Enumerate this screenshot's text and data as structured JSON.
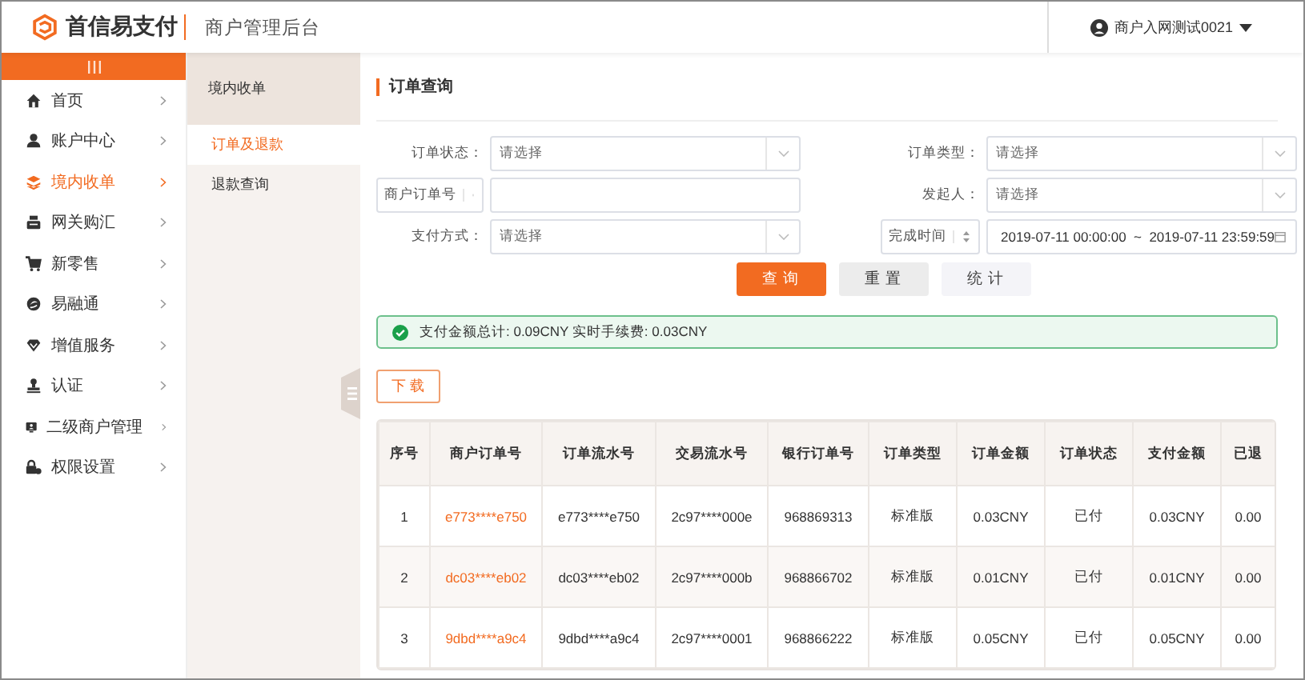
{
  "header": {
    "brand": "首信易支付",
    "app_title": "商户管理后台",
    "user": {
      "name": "商户入网测试0021"
    }
  },
  "sidebar": {
    "items": [
      {
        "label": "首页",
        "selected": false
      },
      {
        "label": "账户中心",
        "selected": false
      },
      {
        "label": "境内收单",
        "selected": true
      },
      {
        "label": "网关购汇",
        "selected": false
      },
      {
        "label": "新零售",
        "selected": false
      },
      {
        "label": "易融通",
        "selected": false
      },
      {
        "label": "增值服务",
        "selected": false
      },
      {
        "label": "认证",
        "selected": false
      },
      {
        "label": "二级商户管理",
        "selected": false
      },
      {
        "label": "权限设置",
        "selected": false
      }
    ]
  },
  "submenu": {
    "group": "境内收单",
    "items": [
      {
        "label": "订单及退款",
        "selected": true
      },
      {
        "label": "退款查询",
        "selected": false
      }
    ]
  },
  "page": {
    "title": "订单查询"
  },
  "form": {
    "rows": [
      [
        {
          "kind": "select",
          "label": "订单状态：",
          "placeholder": "请选择"
        },
        {
          "kind": "select",
          "label": "订单类型：",
          "placeholder": "请选择"
        }
      ],
      [
        {
          "kind": "typed-input",
          "type": "商户订单号"
        },
        {
          "kind": "select",
          "label": "发起人：",
          "placeholder": "请选择"
        }
      ],
      [
        {
          "kind": "select",
          "label": "支付方式：",
          "placeholder": "请选择"
        },
        {
          "kind": "typed-range",
          "type": "完成时间",
          "start": "2019-07-11 00:00:00",
          "separator": "~",
          "end": "2019-07-11 23:59:59"
        }
      ]
    ]
  },
  "buttons": [
    {
      "label": "查 询",
      "kind": "primary"
    },
    {
      "label": "重 置",
      "kind": "default"
    },
    {
      "label": "统 计",
      "kind": "light"
    }
  ],
  "alert": {
    "kind": "success",
    "text": "支付金额总计: 0.09CNY 实时手续费: 0.03CNY"
  },
  "download": {
    "label": "下 载"
  },
  "table": {
    "columns": [
      {
        "label": "序号",
        "kind": "text"
      },
      {
        "label": "商户订单号",
        "kind": "link"
      },
      {
        "label": "订单流水号",
        "kind": "text"
      },
      {
        "label": "交易流水号",
        "kind": "text"
      },
      {
        "label": "银行订单号",
        "kind": "text"
      },
      {
        "label": "订单类型",
        "kind": "text"
      },
      {
        "label": "订单金额",
        "kind": "text"
      },
      {
        "label": "订单状态",
        "kind": "text"
      },
      {
        "label": "支付金额",
        "kind": "text"
      },
      {
        "label": "已退",
        "kind": "text"
      }
    ],
    "rows": [
      [
        "1",
        "e773****e750",
        "e773****e750",
        "2c97****000e",
        "968869313",
        "标准版",
        "0.03CNY",
        "已付",
        "0.03CNY",
        "0.00"
      ],
      [
        "2",
        "dc03****eb02",
        "dc03****eb02",
        "2c97****000b",
        "968866702",
        "标准版",
        "0.01CNY",
        "已付",
        "0.01CNY",
        "0.00"
      ],
      [
        "3",
        "9dbd****a9c4",
        "9dbd****a9c4",
        "2c97****0001",
        "968866222",
        "标准版",
        "0.05CNY",
        "已付",
        "0.05CNY",
        "0.00"
      ]
    ]
  }
}
